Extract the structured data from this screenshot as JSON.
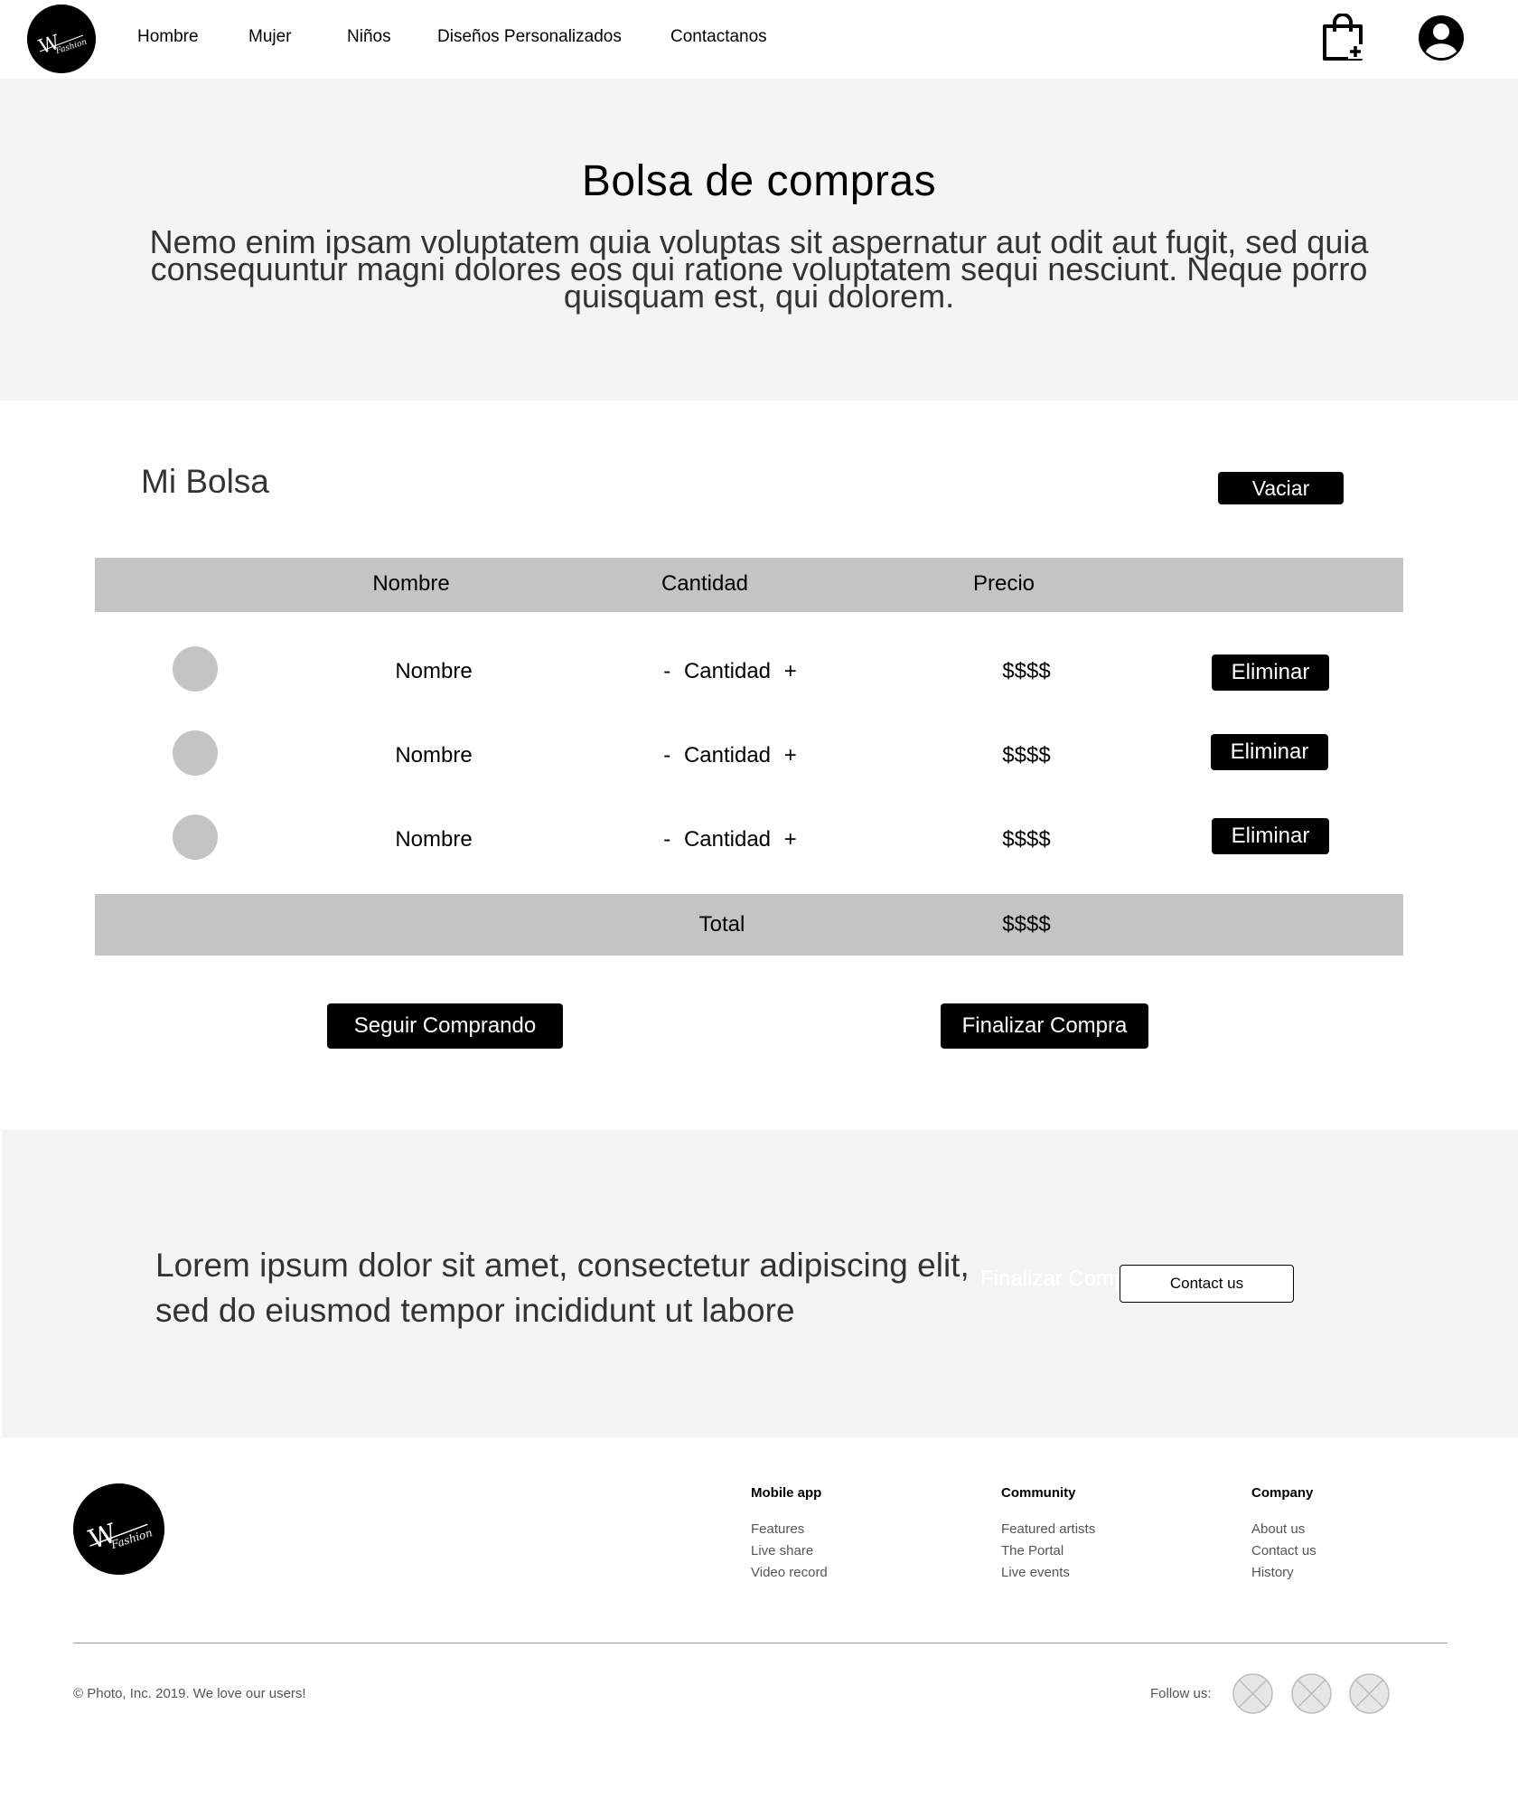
{
  "header": {
    "logo_text": "W Fashion",
    "nav": [
      "Hombre",
      "Mujer",
      "Niños",
      "Diseños Personalizados",
      "Contactanos"
    ],
    "icons": [
      "shopping-bag-add-icon",
      "user-account-icon"
    ]
  },
  "hero": {
    "title": "Bolsa de compras",
    "text": "Nemo enim ipsam voluptatem quia voluptas sit aspernatur aut odit aut fugit, sed quia consequuntur magni dolores eos qui ratione voluptatem sequi nesciunt. Neque porro quisquam est, qui dolorem."
  },
  "bag": {
    "title": "Mi Bolsa",
    "clear_label": "Vaciar",
    "columns": [
      "Nombre",
      "Cantidad",
      "Precio"
    ],
    "rows": [
      {
        "name": "Nombre",
        "minus": "-",
        "qty": "Cantidad",
        "plus": "+",
        "price": "$$$$",
        "remove_label": "Eliminar"
      },
      {
        "name": "Nombre",
        "minus": "-",
        "qty": "Cantidad",
        "plus": "+",
        "price": "$$$$",
        "remove_label": "Eliminar"
      },
      {
        "name": "Nombre",
        "minus": "-",
        "qty": "Cantidad",
        "plus": "+",
        "price": "$$$$",
        "remove_label": "Eliminar"
      }
    ],
    "total_label": "Total",
    "total_value": "$$$$",
    "continue_label": "Seguir Comprando",
    "checkout_label": "Finalizar Compra"
  },
  "cta": {
    "text": "Lorem ipsum dolor sit amet, consectetur adipiscing elit, sed do eiusmod tempor incididunt ut labore",
    "ghost_label": "Finalizar Compra",
    "contact_label": "Contact us"
  },
  "footer": {
    "columns": [
      {
        "title": "Mobile app",
        "links": [
          "Features",
          "Live share",
          "Video record"
        ]
      },
      {
        "title": "Community",
        "links": [
          "Featured artists",
          "The Portal",
          "Live events"
        ]
      },
      {
        "title": "Company",
        "links": [
          "About us",
          "Contact us",
          "History"
        ]
      }
    ],
    "copyright": "© Photo, Inc. 2019. We love our users!",
    "follow_label": "Follow us:",
    "social_icons": [
      "social-placeholder-icon",
      "social-placeholder-icon",
      "social-placeholder-icon"
    ]
  },
  "colors": {
    "panel_bg": "#f4f4f4",
    "table_bar": "#c4c4c4",
    "button_bg": "#000000",
    "button_text": "#ffffff"
  }
}
